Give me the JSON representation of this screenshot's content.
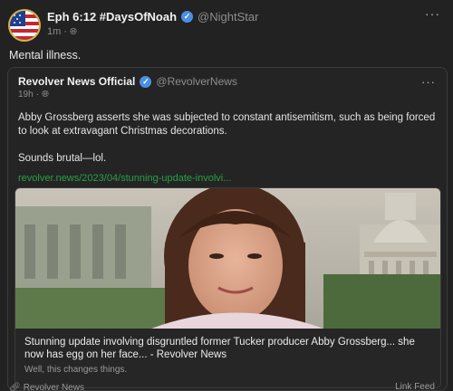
{
  "post": {
    "author_name": "Eph 6:12 #DaysOfNoah",
    "handle": "@NightStar",
    "time": "1m",
    "text": "Mental illness."
  },
  "quoted": {
    "author_name": "Revolver News Official",
    "handle": "@RevolverNews",
    "time": "19h",
    "body_lines": [
      "Abby Grossberg asserts she was subjected to constant antisemitism, such as being forced to look at extravagant Christmas decorations.",
      "Sounds brutal—lol."
    ],
    "link": "revolver.news/2023/04/stunning-update-involvi...",
    "card": {
      "title": "Stunning update involving disgruntled former Tucker producer Abby Grossberg... she now has egg on her face... - Revolver News",
      "description": "Well, this changes things."
    }
  },
  "footer": {
    "source": "Revolver News",
    "right": "Link Feed"
  },
  "icons": {
    "verified": "verified-badge-icon",
    "globe": "globe-icon",
    "more": "more-options-icon",
    "link": "link-icon"
  },
  "colors": {
    "background": "#222222",
    "link_green": "#27a243",
    "verified_blue": "#4a90e2"
  }
}
